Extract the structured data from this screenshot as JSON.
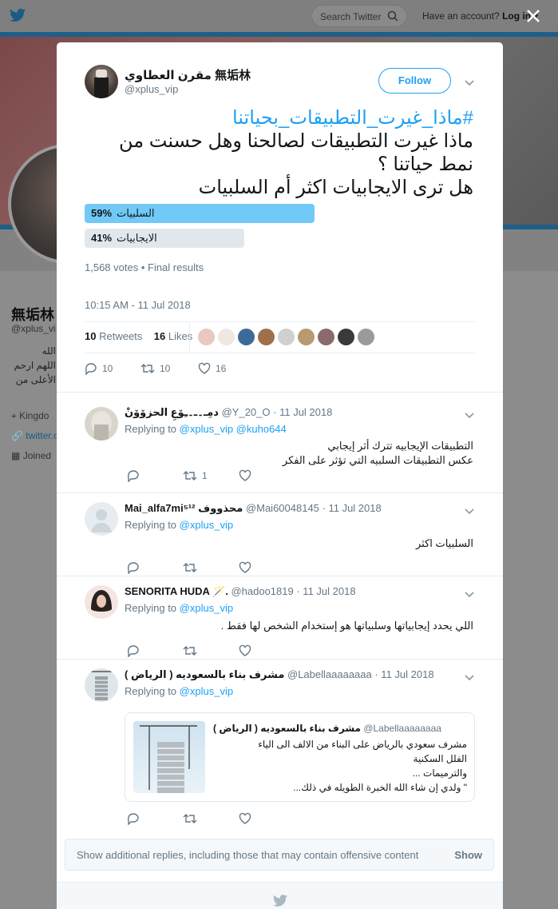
{
  "topbar": {
    "search_placeholder": "Search Twitter",
    "account_text": "Have an account?",
    "login_label": "Log in"
  },
  "background_profile": {
    "name": "無垢林",
    "handle": "@xplus_vi",
    "bio_lines": [
      "الله",
      "اللهم ارحم",
      "الأعلى من"
    ],
    "location": "Kingdo",
    "website": "twitter.c",
    "joined": "Joined"
  },
  "tweet": {
    "author_name": "مقرن العطاوي 無垢林",
    "author_handle": "@xplus_vip",
    "follow_label": "Follow",
    "hashtag": "#ماذا_غيرت_التطبيقات_بحياتنا",
    "text_line1": "ماذا غيرت التطبيقات لصالحنا وهل حسنت من",
    "text_line2": "نمط حياتنا ؟",
    "text_line3": "هل ترى الايجابيات اكثر أم السلبيات",
    "poll": [
      {
        "label": "السلبيات",
        "pct_label": "59%",
        "fraction": 0.59,
        "winner": true
      },
      {
        "label": "الايجابيات",
        "pct_label": "41%",
        "fraction": 0.41,
        "winner": false
      }
    ],
    "votes": "1,568 votes",
    "poll_status": "Final results",
    "timestamp": "10:15 AM - 11 Jul 2018",
    "retweets_count": "10",
    "retweets_label": "Retweets",
    "likes_count": "16",
    "likes_label": "Likes",
    "reply_count": "10",
    "retweet_count": "10",
    "like_count": "16"
  },
  "replies": [
    {
      "name": "دمِـ۔ـ۔ـِۆعِ الحزۆۆنْ",
      "handle": "@Y_20_O",
      "date": "· 11 Jul 2018",
      "replying_prefix": "Replying to",
      "replying_to": "@xplus_vip @kuho644",
      "text_lines": [
        "التطبيقات الإيجابيه تترك أثر إيجابي",
        "عكس التطبيقات السلبيه التي تؤثر على الفكر"
      ],
      "retweet_count": "1"
    },
    {
      "name": "Mai_alfa7mi⁵¹² محذووف",
      "handle": "@Mai60048145",
      "date": "· 11 Jul 2018",
      "replying_prefix": "Replying to",
      "replying_to": "@xplus_vip",
      "text_lines": [
        "السلبيات اكثر"
      ],
      "retweet_count": ""
    },
    {
      "name": "SENORITA HUDA 🪄.",
      "handle": "@hadoo1819",
      "date": "· 11 Jul 2018",
      "replying_prefix": "Replying to",
      "replying_to": "@xplus_vip",
      "text_lines": [
        "اللي يحدد إيجابياتها وسلبياتها هو إستخدام الشخص لها فقط ."
      ],
      "retweet_count": ""
    },
    {
      "name": "مشرف بناء بالسعوديه ( الرياض )",
      "handle": "@Labellaaaaaaaa",
      "date": "· 11 Jul 2018",
      "replying_prefix": "Replying to",
      "replying_to": "@xplus_vip",
      "text_lines": [],
      "retweet_count": ""
    }
  ],
  "quote": {
    "name": "مشرف بناء بالسعوديه ( الرياض )",
    "handle": "@Labellaaaaaaaa",
    "text_lines": [
      "مشرف سعودي بالرياض على البناء من الالف الى الياء",
      "الفلل السكنية",
      "والترميمات ...",
      "\" ولدي إن شاء الله الخبرة الطويله في ذلك..."
    ]
  },
  "more_replies": {
    "text": "Show additional replies, including those that may contain offensive content",
    "show_label": "Show"
  },
  "colors": {
    "accent": "#1da1f2",
    "poll_winner": "#71c9f8",
    "poll_loser": "#e1e8ed",
    "muted": "#657786"
  }
}
